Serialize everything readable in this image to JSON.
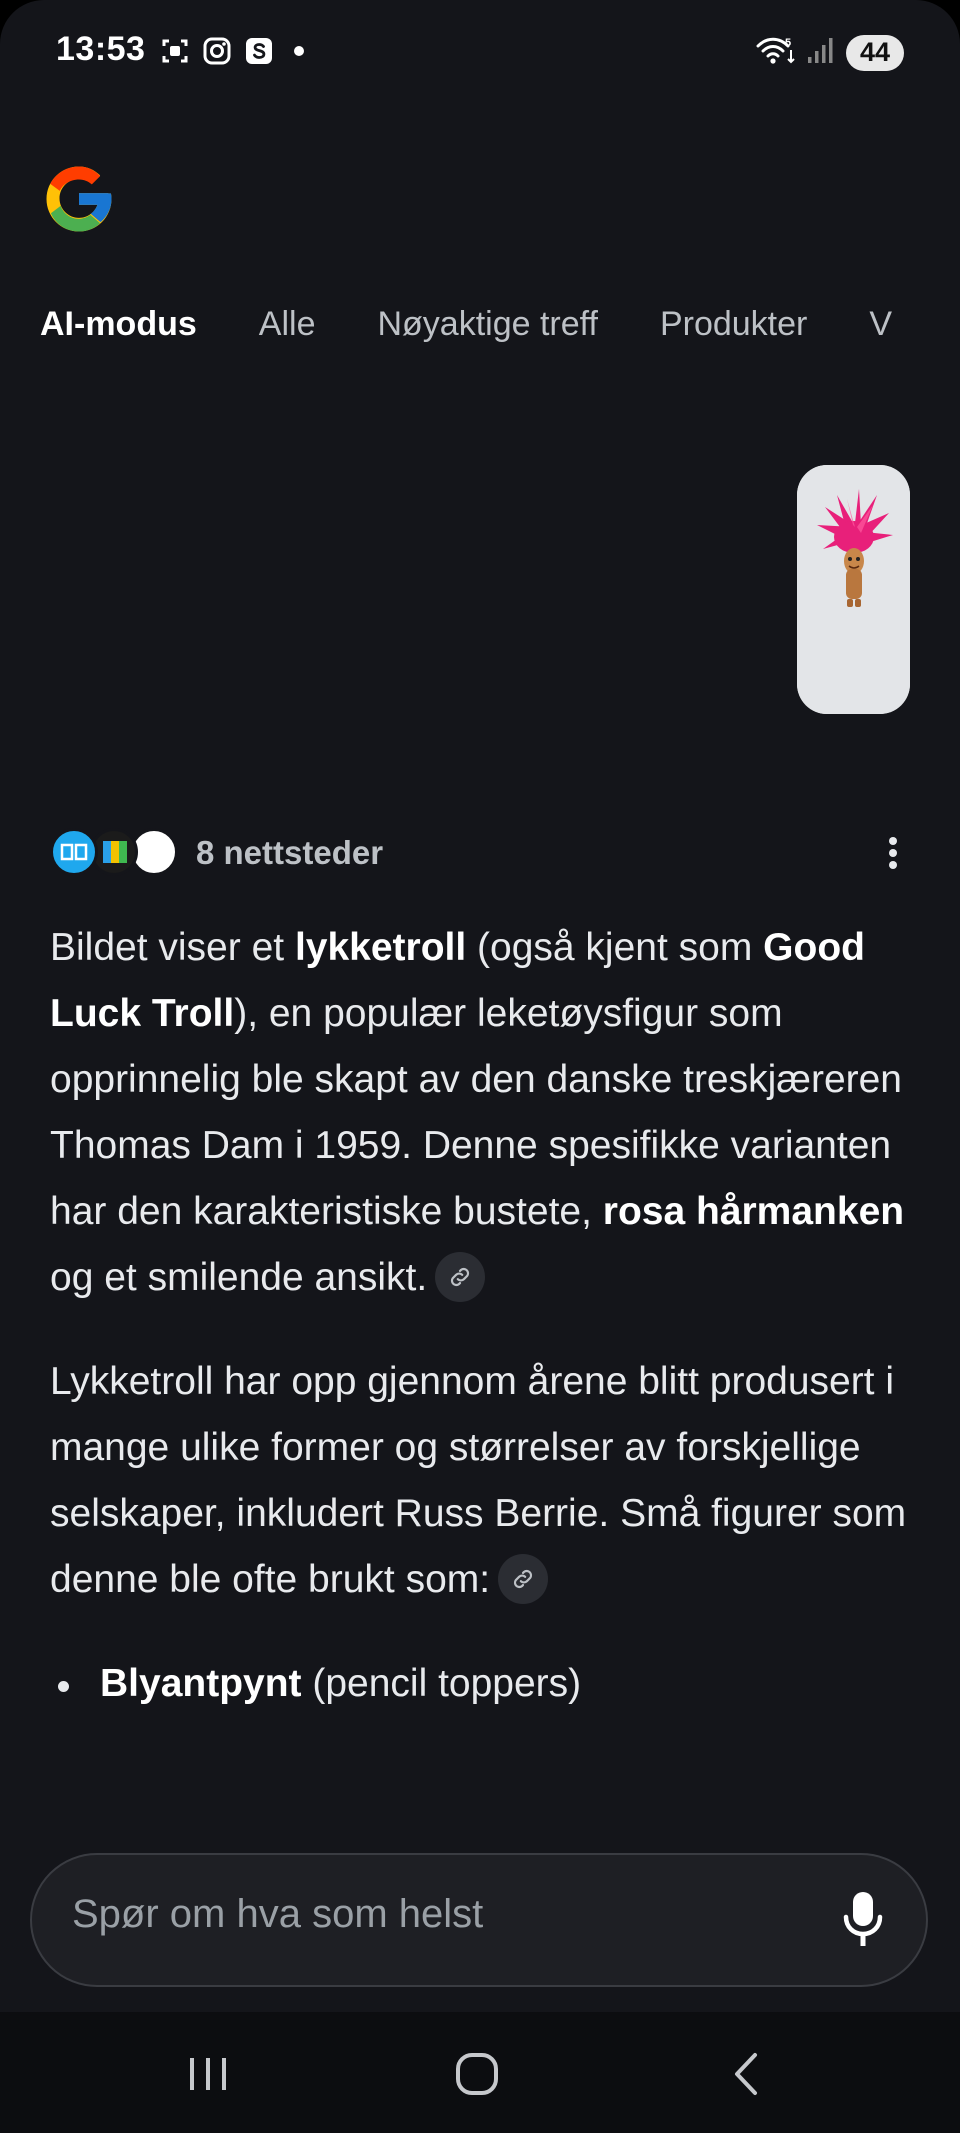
{
  "status_bar": {
    "time": "13:53",
    "battery": "44",
    "wifi_label": "5"
  },
  "tabs": [
    {
      "label": "AI-modus",
      "active": true
    },
    {
      "label": "Alle",
      "active": false
    },
    {
      "label": "Nøyaktige treff",
      "active": false
    },
    {
      "label": "Produkter",
      "active": false
    },
    {
      "label": "V",
      "active": false
    }
  ],
  "sources": {
    "label": "8 nettsteder"
  },
  "answer": {
    "p1": {
      "t1": "Bildet viser et ",
      "b1": "lykketroll",
      "t2": " (også kjent som ",
      "b2": "Good Luck Troll",
      "t3": "), en populær leketøysfigur som opprinnelig ble skapt av den danske treskjæreren Thomas Dam i 1959. Denne spesifikke varianten har den karakteristiske bustete, ",
      "b3": "rosa hårmanken",
      "t4": " og et smilende ansikt."
    },
    "p2": "Lykketroll har opp gjennom årene blitt produsert i mange ulike former og størrelser av forskjellige selskaper, inkludert Russ Berrie. Små figurer som denne ble ofte brukt som:",
    "bullets": [
      {
        "bold": "Blyantpynt",
        "rest": " (pencil toppers)"
      }
    ]
  },
  "search": {
    "placeholder": "Spør om hva som helst"
  },
  "colors": {
    "background": "#14151a",
    "text": "#e8eaed",
    "muted": "#bdc1c6",
    "troll_hair": "#e8207a"
  }
}
